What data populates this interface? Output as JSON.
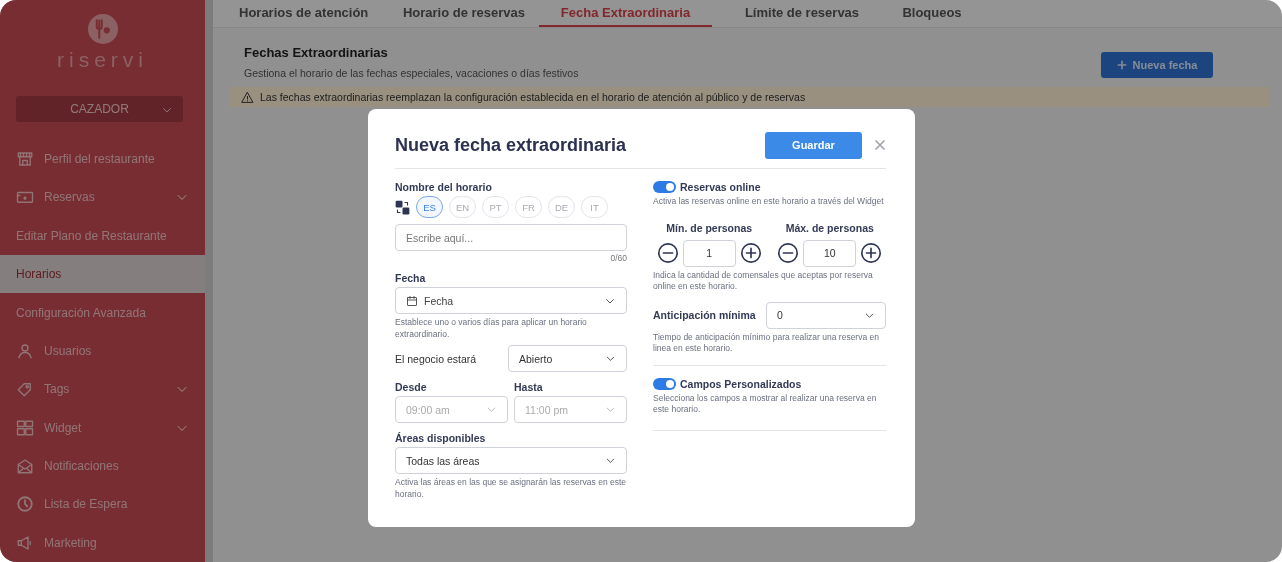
{
  "sidebar": {
    "logo_text": "riservi",
    "branch_select": "CAZADOR",
    "items": [
      {
        "label": "Perfil del restaurante",
        "has_submenu": false,
        "selected": false
      },
      {
        "label": "Reservas",
        "has_submenu": true,
        "selected": false
      },
      {
        "label": "Editar Plano de Restaurante",
        "has_submenu": false,
        "selected": false
      },
      {
        "label": "Horarios",
        "has_submenu": false,
        "selected": true
      },
      {
        "label": "Configuración Avanzada",
        "has_submenu": false,
        "selected": false
      },
      {
        "label": "Usuarios",
        "has_submenu": false,
        "selected": false
      },
      {
        "label": "Tags",
        "has_submenu": true,
        "selected": false
      },
      {
        "label": "Widget",
        "has_submenu": true,
        "selected": false
      },
      {
        "label": "Notificaciones",
        "has_submenu": false,
        "selected": false
      },
      {
        "label": "Lista de Espera",
        "has_submenu": false,
        "selected": false
      },
      {
        "label": "Marketing",
        "has_submenu": false,
        "selected": false
      }
    ]
  },
  "tabs": [
    {
      "label": "Horarios de atención",
      "selected": false
    },
    {
      "label": "Horario de reservas",
      "selected": false
    },
    {
      "label": "Fecha Extraordinaria",
      "selected": true
    },
    {
      "label": "Límite de reservas",
      "selected": false
    },
    {
      "label": "Bloqueos",
      "selected": false
    }
  ],
  "page": {
    "title": "Fechas Extraordinarias",
    "subtitle": "Gestiona el horario de las fechas especiales, vacaciones o días festivos",
    "new_button": "Nueva fecha",
    "warning": "Las fechas extraordinarias reemplazan la configuración establecida en el horario de atención al público y de reservas"
  },
  "modal": {
    "title": "Nueva fecha extraordinaria",
    "save_button": "Guardar",
    "name": {
      "label": "Nombre del horario",
      "languages": [
        {
          "code": "ES",
          "selected": true
        },
        {
          "code": "EN",
          "selected": false
        },
        {
          "code": "PT",
          "selected": false
        },
        {
          "code": "FR",
          "selected": false
        },
        {
          "code": "DE",
          "selected": false
        },
        {
          "code": "IT",
          "selected": false
        }
      ],
      "placeholder": "Escribe aquí...",
      "counter": "0/60"
    },
    "date": {
      "label": "Fecha",
      "placeholder": "Fecha",
      "hint": "Establece uno o varios días para aplicar un horario extraordinario."
    },
    "business": {
      "label": "El negocio estará",
      "value": "Abierto"
    },
    "from": {
      "label": "Desde",
      "value": "09:00 am",
      "disabled": true
    },
    "to": {
      "label": "Hasta",
      "value": "11:00 pm",
      "disabled": true
    },
    "areas": {
      "label": "Áreas disponibles",
      "value": "Todas las áreas",
      "hint": "Activa las áreas en las que se asignarán las reservas en este horario."
    },
    "online": {
      "label": "Reservas online",
      "on": true,
      "hint": "Activa las reservas online en este horario a través del Widget"
    },
    "min_people": {
      "label": "Mín. de personas",
      "value": "1"
    },
    "max_people": {
      "label": "Máx. de personas",
      "value": "10"
    },
    "people_hint": "Indica la cantidad de comensales que aceptas por reserva online en este horario.",
    "advance": {
      "label": "Anticipación mínima",
      "value": "0",
      "hint": "Tiempo de anticipación mínimo para realizar una reserva en linea en este horario."
    },
    "custom_fields": {
      "label": "Campos Personalizados",
      "on": true,
      "hint": "Selecciona los campos a mostrar al realizar una reserva en este horario."
    }
  }
}
